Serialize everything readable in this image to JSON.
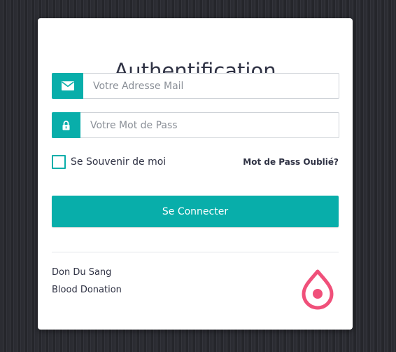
{
  "form": {
    "title": "Authentification",
    "email": {
      "placeholder": "Votre Adresse Mail",
      "value": "",
      "icon": "envelope-icon"
    },
    "password": {
      "placeholder": "Votre Mot de Pass",
      "value": "",
      "icon": "lock-icon"
    },
    "remember_label": "Se Souvenir de moi",
    "remember_checked": false,
    "forgot_label": "Mot de Pass Oublié?",
    "submit_label": "Se Connecter"
  },
  "footer": {
    "line1": "Don Du Sang",
    "line2": "Blood Donation",
    "logo_icon": "blood-drop-icon"
  },
  "colors": {
    "accent": "#08aeaa",
    "logo": "#f0507a",
    "text": "#2f3244",
    "background": "#2e2f35"
  }
}
